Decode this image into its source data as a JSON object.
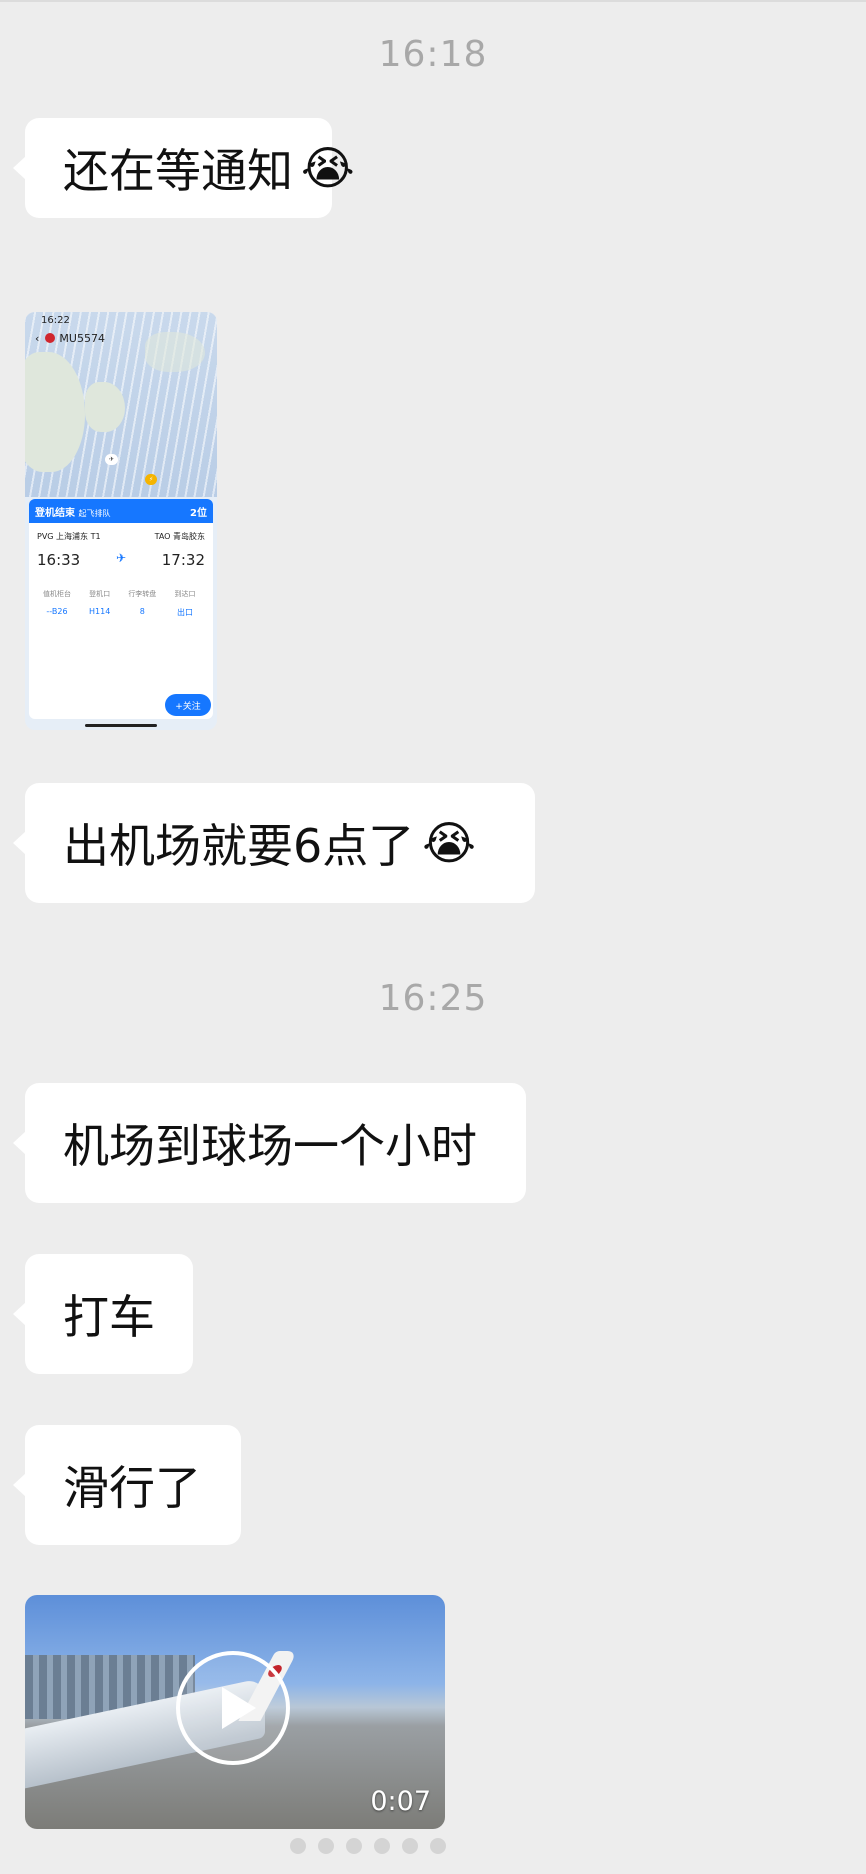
{
  "timestamps": [
    "16:18",
    "16:25"
  ],
  "messages": [
    {
      "text": "还在等通知",
      "emoji": "😭"
    },
    {
      "text": "出机场就要6点了",
      "emoji": "😭"
    },
    {
      "text": "机场到球场一个小时"
    },
    {
      "text": "打车"
    },
    {
      "text": "滑行了"
    }
  ],
  "screenshot": {
    "status_time": "16:22",
    "flight_no": "MU5574",
    "bluebar_left": "登机结束",
    "bluebar_mid": "起飞排队",
    "bluebar_right": "2位",
    "dep_code": "PVG 上海浦东 T1",
    "arr_code": "TAO 青岛胶东",
    "dep_time": "16:33",
    "arr_time": "17:32",
    "grid": [
      "值机柜台",
      "登机口",
      "行李转盘",
      "到达口"
    ],
    "grid_vals": [
      "--B26",
      "H114",
      "8",
      "出口"
    ],
    "follow": "+关注"
  },
  "video": {
    "duration": "0:07",
    "play_icon": "play-icon"
  }
}
